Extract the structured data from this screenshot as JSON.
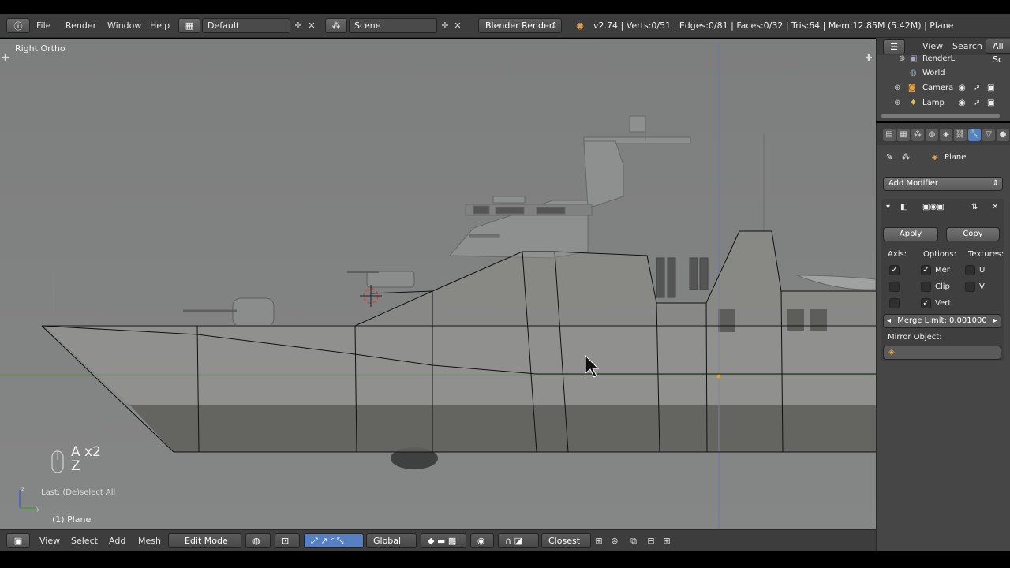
{
  "menus": {
    "file": "File",
    "render": "Render",
    "window": "Window",
    "help": "Help"
  },
  "screen_layout": "Default",
  "scene": "Scene",
  "render_engine": "Blender Render",
  "stats": "v2.74 | Verts:0/51 | Edges:0/81 | Faces:0/32 | Tris:64 | Mem:12.85M (5.42M) | Plane",
  "viewport": {
    "view_label": "Right Ortho",
    "hint_line1": "A x2",
    "hint_line2": "Z",
    "last_operator": "Last: (De)select All",
    "object_label": "(1) Plane"
  },
  "bottom_header": {
    "view": "View",
    "select": "Select",
    "add": "Add",
    "mesh": "Mesh",
    "mode": "Edit Mode",
    "orientation": "Global",
    "snap_target": "Closest"
  },
  "outliner": {
    "view": "View",
    "search": "Search",
    "filter": "All Sc",
    "items": [
      {
        "label": "RenderL",
        "icon": "render-layer-icon"
      },
      {
        "label": "World",
        "icon": "world-icon"
      },
      {
        "label": "Camera",
        "icon": "camera-icon"
      },
      {
        "label": "Lamp",
        "icon": "lamp-icon"
      }
    ]
  },
  "properties": {
    "context_object": "Plane",
    "add_modifier": "Add Modifier",
    "apply": "Apply",
    "copy": "Copy",
    "axis_label": "Axis:",
    "options_label": "Options:",
    "textures_label": "Textures:",
    "merge_label": "Mer",
    "clip_label": "Clip",
    "vert_label": "Vert",
    "u_label": "U",
    "v_label": "V",
    "merge_limit": "Merge Limit: 0.001000",
    "mirror_object_label": "Mirror Object:",
    "checks": {
      "axis_x": true,
      "axis_y": false,
      "axis_z": false,
      "merge": true,
      "clipping": false,
      "vertex_groups": true,
      "tex_u": false,
      "tex_v": false
    }
  },
  "colors": {
    "header_bg": "#3d3d3d",
    "viewport_bg": "#7f8080",
    "panel_bg": "#464646",
    "active_blue": "#5680c2"
  }
}
